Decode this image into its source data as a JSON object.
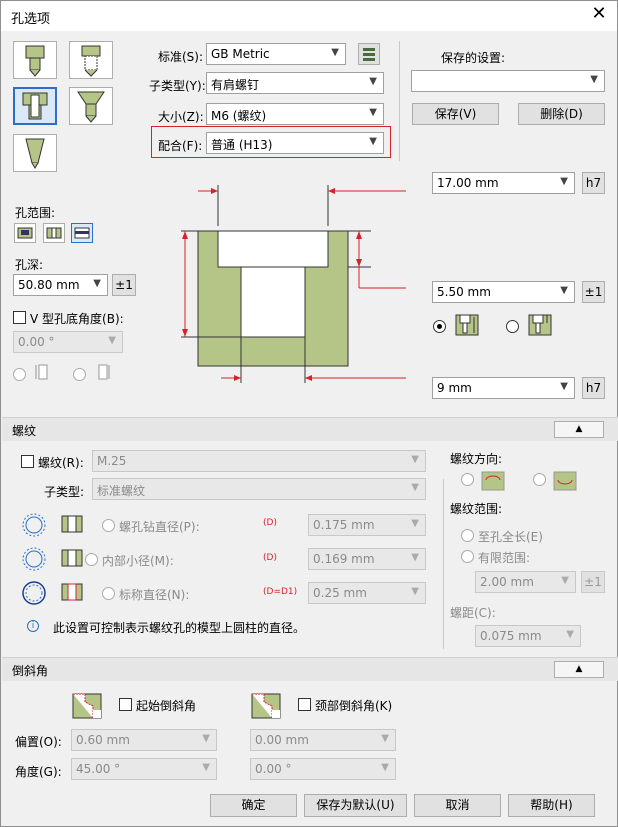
{
  "window": {
    "title": "孔选项",
    "close_glyph": "✕"
  },
  "form": {
    "standard_label": "标准(S):",
    "standard_value": "GB Metric",
    "subtype_label": "子类型(Y):",
    "subtype_value": "有肩螺钉",
    "size_label": "大小(Z):",
    "size_value": "M6 (螺纹)",
    "fit_label": "配合(F):",
    "fit_value": "普通 (H13)"
  },
  "saved": {
    "label": "保存的设置:",
    "value": "",
    "save_btn": "保存(V)",
    "delete_btn": "删除(D)"
  },
  "dims": {
    "dia_value": "17.00 mm",
    "dia_tol_btn": "h7",
    "depth_value": "5.50 mm",
    "depth_tol_btn": "±1",
    "bottom_value": "9 mm",
    "bottom_tol_btn": "h7"
  },
  "left": {
    "range_label": "孔范围:",
    "depth_label": "孔深:",
    "depth_value": "50.80 mm",
    "depth_tol_btn": "±1",
    "vangle_label": "V 型孔底角度(B):",
    "vangle_value": "0.00 °"
  },
  "thread": {
    "section_title": "螺纹",
    "thread_label": "螺纹(R):",
    "thread_value": "M.25",
    "subtype_label": "子类型:",
    "subtype_value": "标准螺纹",
    "tap_label": "螺孔钻直径(P):",
    "tap_tag": "(D)",
    "tap_value": "0.175 mm",
    "minor_label": "内部小径(M):",
    "minor_tag": "(D)",
    "minor_value": "0.169 mm",
    "nominal_label": "标称直径(N):",
    "nominal_tag": "(D=D1)",
    "nominal_value": "0.25 mm",
    "info_icon": "i",
    "info_text": "此设置可控制表示螺纹孔的模型上圆柱的直径。",
    "direction_label": "螺纹方向:",
    "range_label": "螺纹范围:",
    "full_label": "至孔全长(E)",
    "limited_label": "有限范围:",
    "limited_value": "2.00 mm",
    "limited_tol_btn": "±1",
    "pitch_label": "螺距(C):",
    "pitch_value": "0.075 mm"
  },
  "chamfer": {
    "section_title": "倒斜角",
    "start_label": "起始倒斜角",
    "neck_label": "颈部倒斜角(K)",
    "offset_label": "偏置(O):",
    "offset_value1": "0.60 mm",
    "offset_value2": "0.00 mm",
    "angle_label": "角度(G):",
    "angle_value1": "45.00 °",
    "angle_value2": "0.00 °"
  },
  "footer": {
    "ok": "确定",
    "save_default": "保存为默认(U)",
    "cancel": "取消",
    "help": "帮助(H)"
  },
  "colors": {
    "accent": "#2b6fc7",
    "highlight_red": "#d9212c",
    "hole_green": "#b5c487"
  }
}
